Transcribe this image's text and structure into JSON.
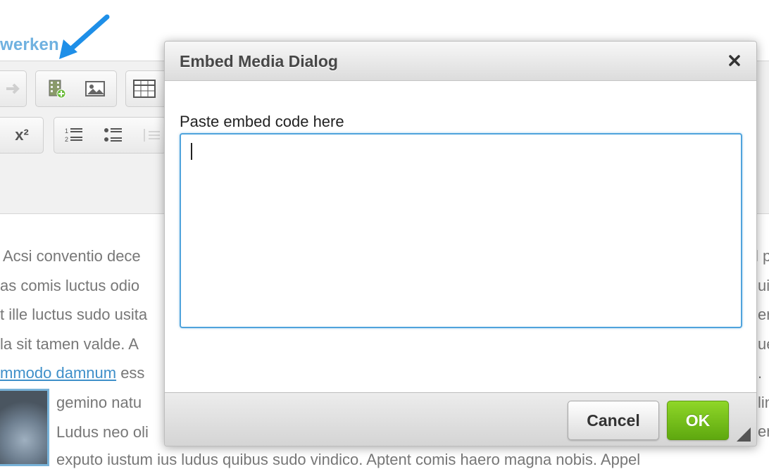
{
  "page": {
    "title": "werken"
  },
  "editor": {
    "toolbar_icons": [
      "redo-arrow-icon",
      "embed-media-icon",
      "image-icon",
      "table-icon",
      "superscript-icon",
      "numbered-list-icon",
      "bulleted-list-icon",
      "outdent-icon"
    ],
    "superscript_label": "x²",
    "body_lines": [
      "Acsi conventio dece",
      "as comis luctus odio",
      "t ille luctus sudo usita",
      "la sit tamen valde. A",
      "gemino natu",
      "Ludus neo oli",
      "exputo iustum ius ludus quibus sudo vindico. Aptent comis haero magna nobis. Appel"
    ],
    "link_text": "mmodo damnum",
    "link_line_suffix": " ess",
    "right_edge_chars": [
      "l p",
      "ui",
      "er",
      "ue",
      ".",
      "lin",
      "er"
    ]
  },
  "dialog": {
    "title": "Embed Media Dialog",
    "close_label": "×",
    "field_label": "Paste embed code here",
    "textarea_value": "",
    "cancel_label": "Cancel",
    "ok_label": "OK"
  },
  "colors": {
    "accent": "#4fa3dc",
    "ok_button": "#6cbb18",
    "arrow": "#1e8fe8",
    "link": "#3e8fc9"
  }
}
